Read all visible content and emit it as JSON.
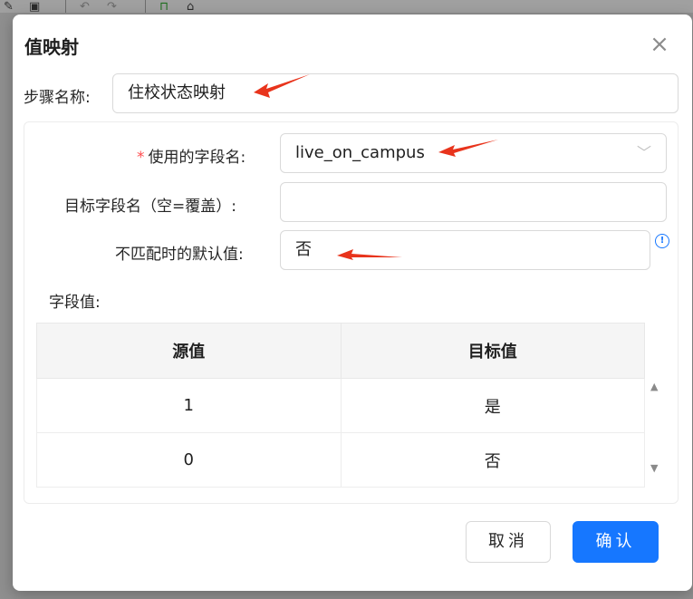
{
  "dialog": {
    "title": "值映射",
    "step_name_label": "步骤名称:",
    "step_name_value": "住校状态映射",
    "field_label": "使用的字段名:",
    "required_mark": "*",
    "field_value": "live_on_campus",
    "target_label": "目标字段名（空=覆盖）:",
    "target_value": "",
    "default_label": "不匹配时的默认值:",
    "default_value": "否",
    "field_values_label": "字段值:",
    "table": {
      "headers": [
        "源值",
        "目标值"
      ],
      "rows": [
        [
          "1",
          "是"
        ],
        [
          "0",
          "否"
        ]
      ]
    },
    "cancel_label": "取消",
    "ok_label": "确认",
    "info_glyph": "!"
  },
  "colors": {
    "primary": "#1677ff",
    "required": "#ff4d4f",
    "annotation_arrow": "#e8341c"
  }
}
